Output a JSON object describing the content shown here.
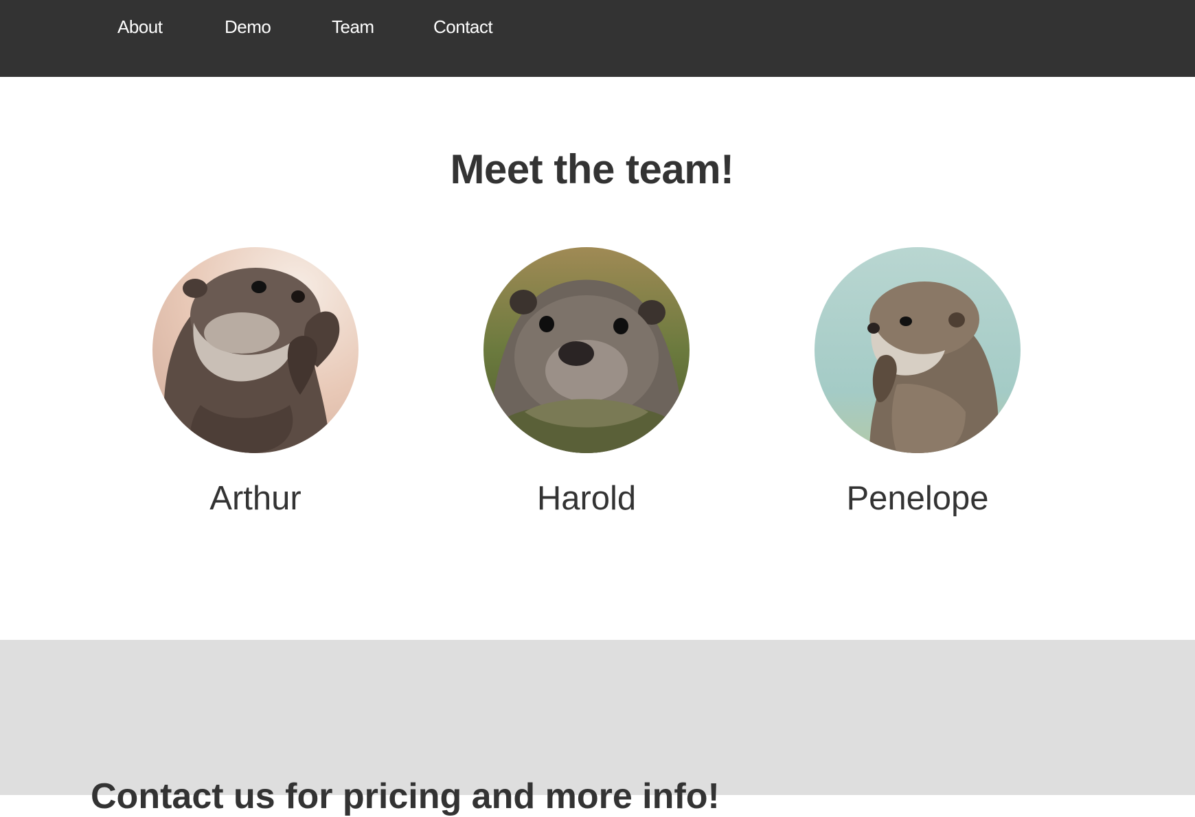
{
  "nav": {
    "links": [
      {
        "label": "About"
      },
      {
        "label": "Demo"
      },
      {
        "label": "Team"
      },
      {
        "label": "Contact"
      }
    ]
  },
  "team": {
    "heading": "Meet the team!",
    "members": [
      {
        "name": "Arthur",
        "photo": "otter-photo-clapping"
      },
      {
        "name": "Harold",
        "photo": "otter-photo-face-front"
      },
      {
        "name": "Penelope",
        "photo": "otter-photo-thinking"
      }
    ]
  },
  "contact": {
    "heading": "Contact us for pricing and more info!"
  },
  "colors": {
    "navbar_bg": "#333333",
    "nav_text": "#ffffff",
    "heading_text": "#333333",
    "contact_bg": "#dedede"
  }
}
